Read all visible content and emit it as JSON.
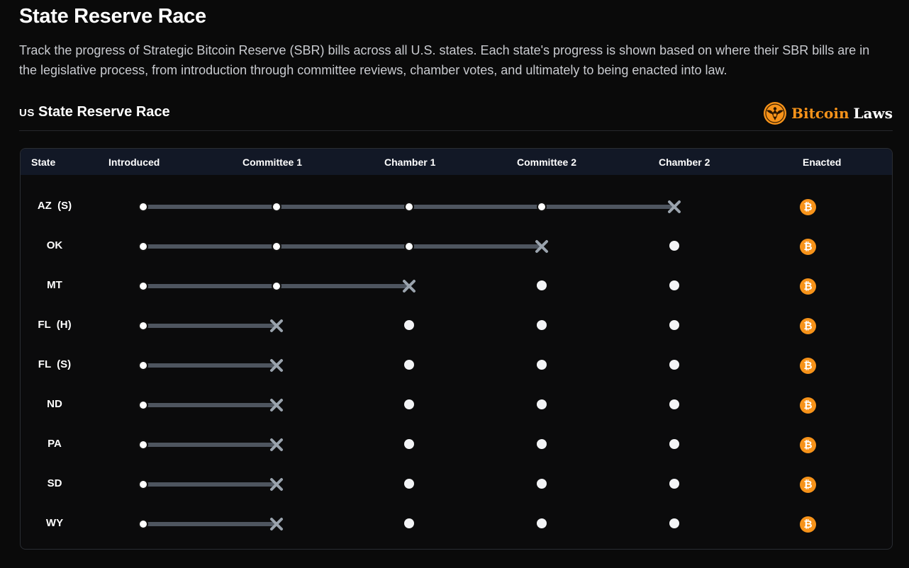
{
  "page": {
    "title": "State Reserve Race",
    "description": "Track the progress of Strategic Bitcoin Reserve (SBR) bills across all U.S. states. Each state's progress is shown based on where their SBR bills are in the legislative process, from introduction through committee reviews, chamber votes, and ultimately to being enacted into law."
  },
  "section": {
    "flag_code": "US",
    "title": "State Reserve Race",
    "brand_word1": "Bitcoin",
    "brand_word2": "Laws",
    "brand_logo_icon": "eagle-seal-icon"
  },
  "colors": {
    "bitcoin_orange": "#f7931a",
    "track": "#4e555f",
    "header_bg": "#121826",
    "failed_mark": "#9aa3ad"
  },
  "table": {
    "columns": [
      "State",
      "Introduced",
      "Committee 1",
      "Chamber 1",
      "Committee 2",
      "Chamber 2",
      "Enacted"
    ],
    "enacted_icon": "bitcoin-icon",
    "rows": [
      {
        "state": "AZ  (S)",
        "stopped_at": 4
      },
      {
        "state": "OK",
        "stopped_at": 3
      },
      {
        "state": "MT",
        "stopped_at": 2
      },
      {
        "state": "FL  (H)",
        "stopped_at": 1
      },
      {
        "state": "FL  (S)",
        "stopped_at": 1
      },
      {
        "state": "ND",
        "stopped_at": 1
      },
      {
        "state": "PA",
        "stopped_at": 1
      },
      {
        "state": "SD",
        "stopped_at": 1
      },
      {
        "state": "WY",
        "stopped_at": 1
      }
    ]
  }
}
